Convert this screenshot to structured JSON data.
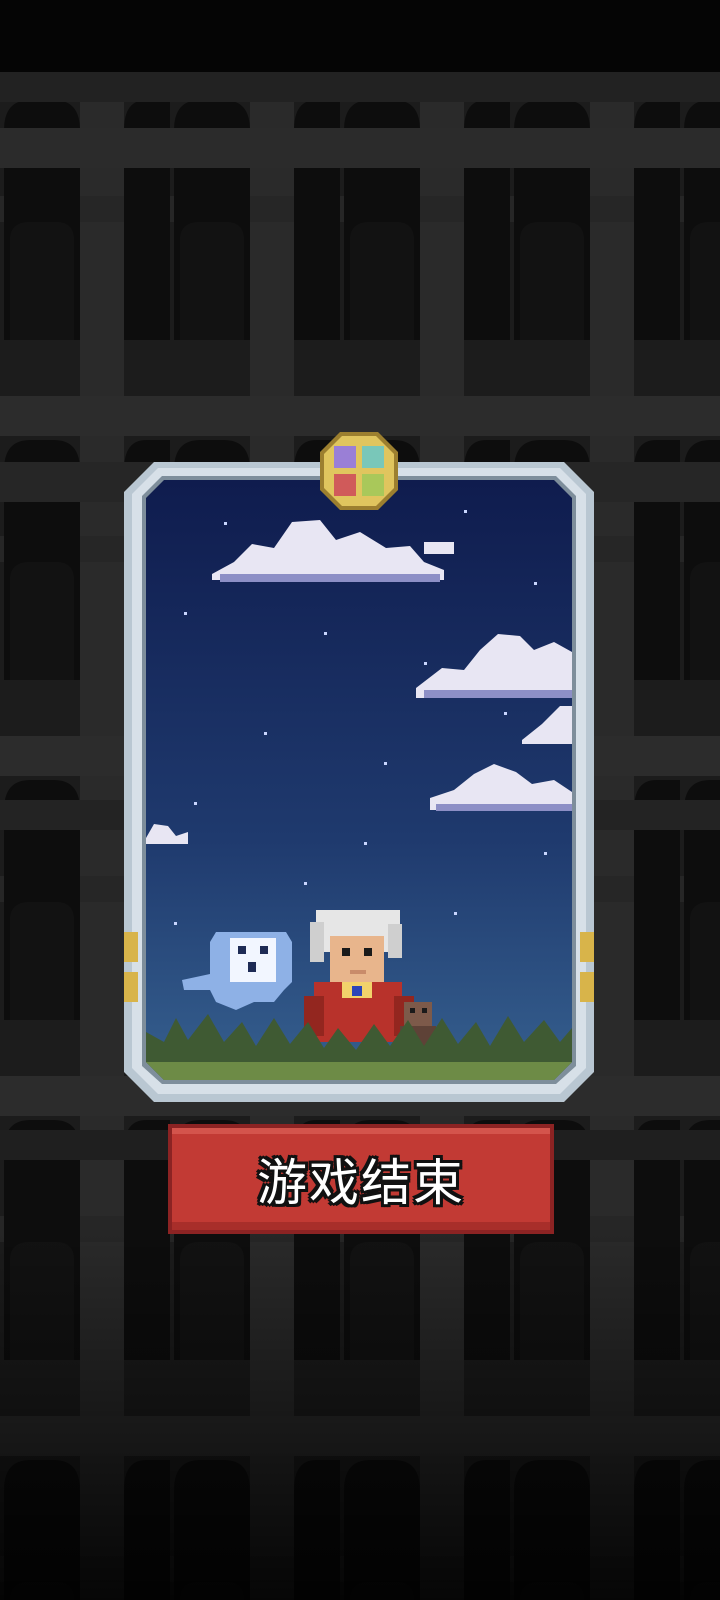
{
  "game_over": {
    "button_label": "游戏结束"
  },
  "scene": {
    "background": "night sky",
    "colors": {
      "sky_top": "#0f1c4e",
      "sky_bottom": "#31588a",
      "frame": "#b9c7d2",
      "button": "#c23a34",
      "cloud": "#e8e6f3",
      "grass": "#3f5a33"
    }
  },
  "icons": {
    "top_gem": "quad-gem-icon",
    "character": "white-haired-hero",
    "ghost": "ghost-spirit",
    "pet": "small-companion"
  }
}
